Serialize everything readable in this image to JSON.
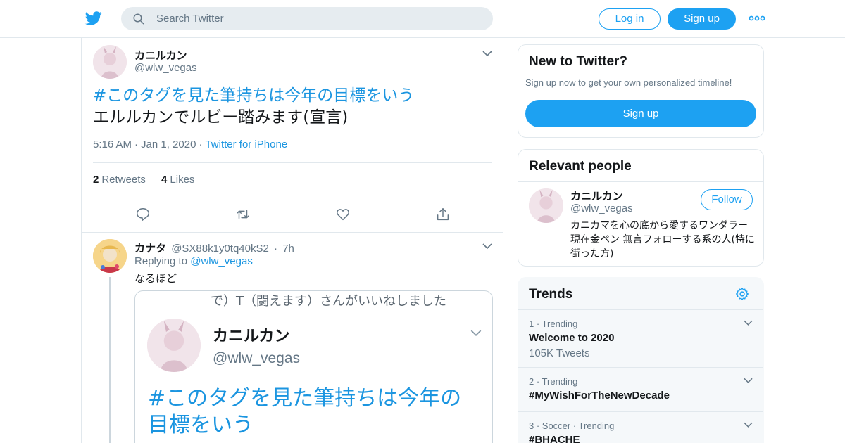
{
  "header": {
    "search_placeholder": "Search Twitter",
    "login_label": "Log in",
    "signup_label": "Sign up",
    "brand_color": "#1da1f2"
  },
  "main_tweet": {
    "name": "カニルカン",
    "handle": "@wlw_vegas",
    "hashtag": "#このタグを見た筆持ちは今年の目標をいう",
    "text": "エルルカンでルビー踏みます(宣言)",
    "time": "5:16 AM",
    "date": "Jan 1, 2020",
    "source": "Twitter for iPhone",
    "retweets_count": "2",
    "retweets_label": "Retweets",
    "likes_count": "4",
    "likes_label": "Likes"
  },
  "reply": {
    "name": "カナタ",
    "handle": "@SX88k1y0tq40kS2",
    "age": "7h",
    "replying_prefix": "Replying to",
    "replying_to": "@wlw_vegas",
    "text": "なるほど",
    "embed": {
      "top_text": "で）T（闘えます）さんがいいねしました",
      "name": "カニルカン",
      "handle": "@wlw_vegas",
      "text": "#このタグを見た筆持ちは今年の目標をいう"
    }
  },
  "new_to_twitter": {
    "title": "New to Twitter?",
    "subtitle": "Sign up now to get your own personalized timeline!",
    "button": "Sign up"
  },
  "relevant_people": {
    "title": "Relevant people",
    "name": "カニルカン",
    "handle": "@wlw_vegas",
    "follow_label": "Follow",
    "bio": "カニカマを心の底から愛するワンダラー 現在金ペン 無言フォローする系の人(特に街った方)"
  },
  "trends": {
    "title": "Trends",
    "items": [
      {
        "meta": "1 · Trending",
        "name": "Welcome to 2020",
        "count": "105K Tweets"
      },
      {
        "meta": "2 · Trending",
        "name": "#MyWishForTheNewDecade",
        "count": ""
      },
      {
        "meta": "3 · Soccer · Trending",
        "name": "#BHACHE",
        "count": ""
      }
    ]
  }
}
